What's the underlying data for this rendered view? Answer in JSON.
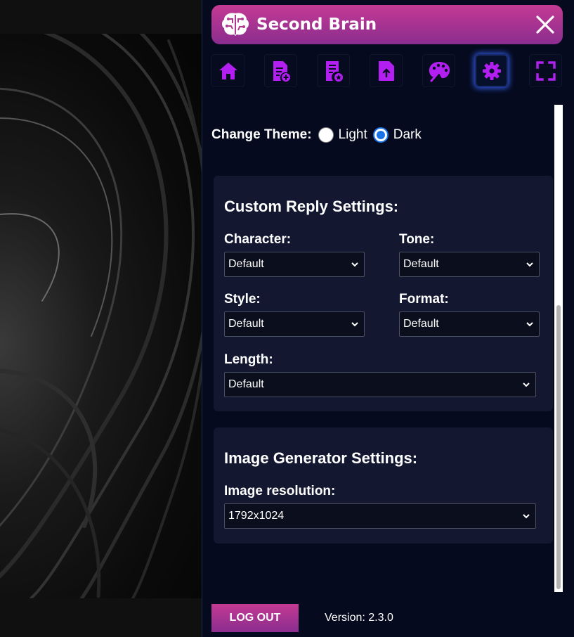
{
  "header": {
    "title": "Second Brain",
    "brand_gradient": [
      "#c43a93",
      "#8a2d8f"
    ],
    "icon": "brain-circuit-icon",
    "close_icon": "close-icon"
  },
  "toolbar": {
    "accent_color": "#b21ff0",
    "items": [
      {
        "name": "home",
        "icon": "home-icon",
        "active": false
      },
      {
        "name": "new-note",
        "icon": "note-add-icon",
        "active": false
      },
      {
        "name": "saved-notes",
        "icon": "note-star-icon",
        "active": false
      },
      {
        "name": "upload",
        "icon": "file-upload-icon",
        "active": false
      },
      {
        "name": "image-generator",
        "icon": "palette-icon",
        "active": false
      },
      {
        "name": "settings",
        "icon": "gear-icon",
        "active": true
      },
      {
        "name": "fullscreen",
        "icon": "fullscreen-icon",
        "active": false
      }
    ]
  },
  "theme": {
    "label": "Change Theme:",
    "options": [
      "Light",
      "Dark"
    ],
    "selected": "Dark"
  },
  "reply_settings": {
    "title": "Custom Reply Settings:",
    "character": {
      "label": "Character:",
      "value": "Default"
    },
    "tone": {
      "label": "Tone:",
      "value": "Default"
    },
    "style": {
      "label": "Style:",
      "value": "Default"
    },
    "format": {
      "label": "Format:",
      "value": "Default"
    },
    "length": {
      "label": "Length:",
      "value": "Default"
    }
  },
  "image_settings": {
    "title": "Image Generator Settings:",
    "resolution": {
      "label": "Image resolution:",
      "value": "1792x1024"
    }
  },
  "footer": {
    "logout_label": "LOG OUT",
    "version": "Version: 2.3.0"
  }
}
